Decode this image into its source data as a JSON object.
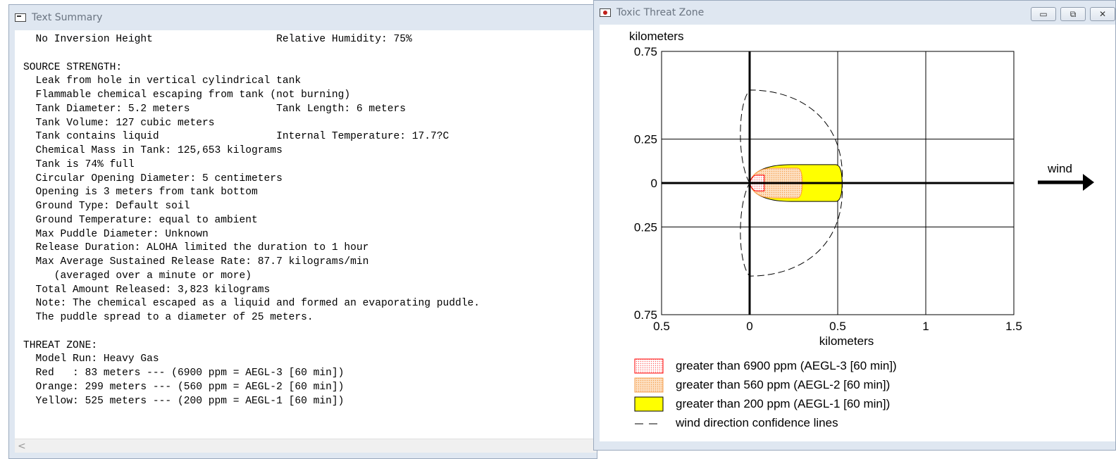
{
  "text_window": {
    "title": "Text Summary",
    "lines": [
      "  No Inversion Height                    Relative Humidity: 75%",
      "",
      "SOURCE STRENGTH:",
      "  Leak from hole in vertical cylindrical tank",
      "  Flammable chemical escaping from tank (not burning)",
      "  Tank Diameter: 5.2 meters              Tank Length: 6 meters",
      "  Tank Volume: 127 cubic meters",
      "  Tank contains liquid                   Internal Temperature: 17.7?C",
      "  Chemical Mass in Tank: 125,653 kilograms",
      "  Tank is 74% full",
      "  Circular Opening Diameter: 5 centimeters",
      "  Opening is 3 meters from tank bottom",
      "  Ground Type: Default soil",
      "  Ground Temperature: equal to ambient",
      "  Max Puddle Diameter: Unknown",
      "  Release Duration: ALOHA limited the duration to 1 hour",
      "  Max Average Sustained Release Rate: 87.7 kilograms/min",
      "     (averaged over a minute or more)",
      "  Total Amount Released: 3,823 kilograms",
      "  Note: The chemical escaped as a liquid and formed an evaporating puddle.",
      "  The puddle spread to a diameter of 25 meters.",
      "",
      "THREAT ZONE:",
      "  Model Run: Heavy Gas",
      "  Red   : 83 meters --- (6900 ppm = AEGL-3 [60 min])",
      "  Orange: 299 meters --- (560 ppm = AEGL-2 [60 min])",
      "  Yellow: 525 meters --- (200 ppm = AEGL-1 [60 min])"
    ],
    "scroll_left_glyph": "<"
  },
  "threat_window": {
    "title": "Toxic Threat Zone",
    "buttons": {
      "minimize": "▭",
      "restore": "⧉",
      "close": "✕"
    }
  },
  "chart_data": {
    "type": "area",
    "ylabel": "kilometers",
    "xlabel": "kilometers",
    "x_ticks": [
      "0.5",
      "0",
      "0.5",
      "1",
      "1.5"
    ],
    "x_tick_values": [
      -0.5,
      0,
      0.5,
      1,
      1.5
    ],
    "y_ticks": [
      "0.75",
      "0.25",
      "0",
      "0.25",
      "0.75"
    ],
    "y_tick_values": [
      0.75,
      0.25,
      0,
      -0.25,
      -0.75
    ],
    "xlim": [
      -0.5,
      1.5
    ],
    "ylim": [
      -0.75,
      0.75
    ],
    "grid": true,
    "wind_label": "wind",
    "zones": [
      {
        "name": "greater than 6900 ppm (AEGL-3 [60 min])",
        "color": "#ff0000",
        "fill": "#ffe8e8",
        "extent_km": 0.083,
        "half_width_km": 0.045
      },
      {
        "name": "greater than 560 ppm (AEGL-2 [60 min])",
        "color": "#ff9933",
        "fill": "#fcd2a8",
        "extent_km": 0.299,
        "half_width_km": 0.085
      },
      {
        "name": "greater than 200 ppm (AEGL-1 [60 min])",
        "color": "#000000",
        "fill": "#ffff00",
        "extent_km": 0.525,
        "half_width_km": 0.105
      }
    ],
    "confidence_legend": "wind direction confidence lines",
    "legend_placement": "bottom"
  }
}
